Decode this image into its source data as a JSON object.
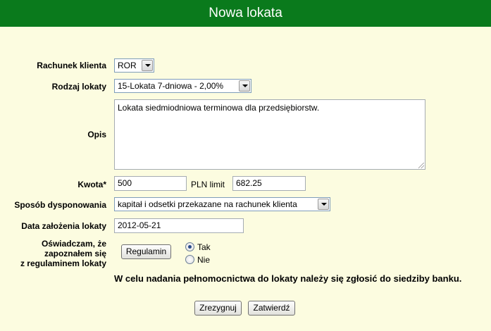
{
  "header": {
    "title": "Nowa lokata"
  },
  "form": {
    "account": {
      "label": "Rachunek klienta",
      "value": "ROR"
    },
    "deposit_type": {
      "label": "Rodzaj lokaty",
      "value": "15-Lokata 7-dniowa - 2,00%"
    },
    "description": {
      "label": "Opis",
      "value": "Lokata siedmiodniowa terminowa dla przedsiębiorstw."
    },
    "amount": {
      "label": "Kwota*",
      "value": "500",
      "currency_limit_text": "PLN limit",
      "limit_value": "682.25"
    },
    "disposition": {
      "label": "Sposób dysponowania",
      "value": "kapitał i odsetki przekazane na rachunek klienta"
    },
    "creation_date": {
      "label": "Data założenia lokaty",
      "value": "2012-05-21"
    },
    "terms": {
      "label_lines": [
        "Oświadczam, że",
        "zapoznałem się",
        "z regulaminem lokaty"
      ],
      "button_label": "Regulamin",
      "options": [
        {
          "label": "Tak",
          "checked": true
        },
        {
          "label": "Nie",
          "checked": false
        }
      ]
    },
    "notice": "W celu nadania pełnomocnictwa do lokaty należy się zgłosić do siedziby banku."
  },
  "actions": {
    "cancel_label": "Zrezygnuj",
    "confirm_label": "Zatwierdź"
  }
}
